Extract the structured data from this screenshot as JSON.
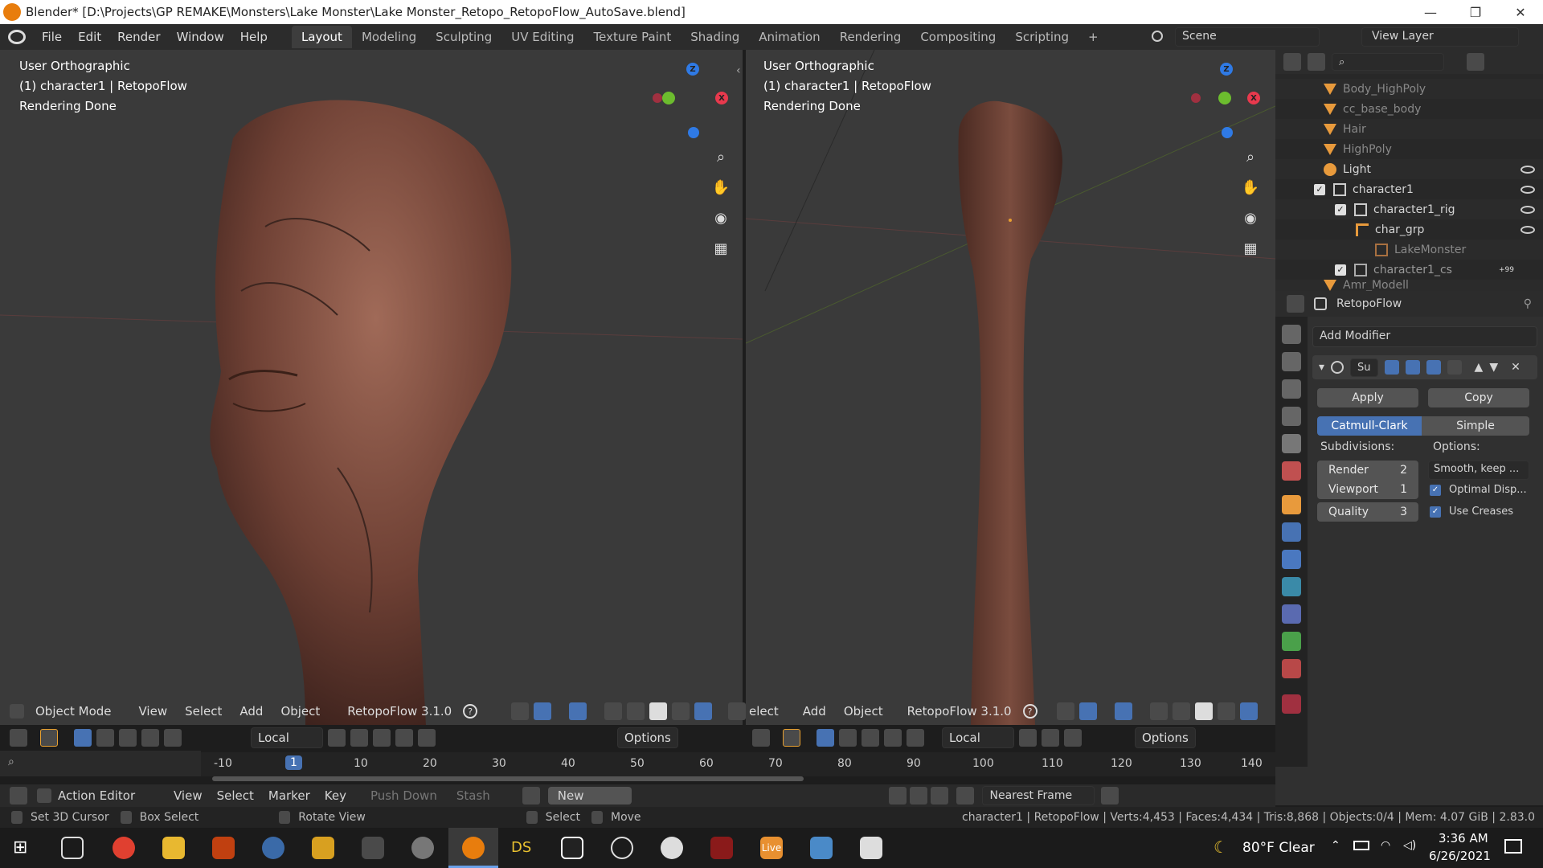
{
  "title_bar": {
    "title": "Blender* [D:\\Projects\\GP REMAKE\\Monsters\\Lake Monster\\Lake Monster_Retopo_RetopoFlow_AutoSave.blend]",
    "minimize": "—",
    "maximize": "❐",
    "close": "✕"
  },
  "menu": {
    "items": [
      "File",
      "Edit",
      "Render",
      "Window",
      "Help"
    ]
  },
  "workspaces": {
    "tabs": [
      "Layout",
      "Modeling",
      "Sculpting",
      "UV Editing",
      "Texture Paint",
      "Shading",
      "Animation",
      "Rendering",
      "Compositing",
      "Scripting"
    ],
    "active": "Layout",
    "add": "+"
  },
  "scene": {
    "label": "Scene",
    "view_layer": "View Layer"
  },
  "viewport_left": {
    "line1": "User Orthographic",
    "line2": "(1) character1 | RetopoFlow",
    "line3": "Rendering Done"
  },
  "viewport_right": {
    "line1": "User Orthographic",
    "line2": "(1) character1 | RetopoFlow",
    "line3": "Rendering Done"
  },
  "gizmo": {
    "z": "Z",
    "x": "X"
  },
  "header_left": {
    "mode": "Object Mode",
    "view": "View",
    "select": "Select",
    "add": "Add",
    "object": "Object",
    "addon": "RetopoFlow 3.1.0",
    "pivot": "Local",
    "options": "Options"
  },
  "header_right": {
    "select": "elect",
    "add": "Add",
    "object": "Object",
    "addon": "RetopoFlow 3.1.0",
    "pivot": "Local",
    "options": "Options"
  },
  "outliner": {
    "items": [
      {
        "label": "Body_HighPoly",
        "dim": true
      },
      {
        "label": "cc_base_body",
        "dim": true
      },
      {
        "label": "Hair",
        "dim": true
      },
      {
        "label": "HighPoly",
        "dim": true
      },
      {
        "label": "Light",
        "dim": false
      },
      {
        "label": "character1",
        "dim": false
      },
      {
        "label": "character1_rig",
        "dim": false
      },
      {
        "label": "char_grp",
        "dim": false
      },
      {
        "label": "LakeMonster",
        "dim": true
      },
      {
        "label": "character1_cs",
        "dim": true
      },
      {
        "label": "Amr_Modell",
        "dim": true
      }
    ],
    "badge": "+99"
  },
  "properties": {
    "object_name": "RetopoFlow",
    "add_modifier": "Add Modifier",
    "modifier_name": "Su",
    "apply": "Apply",
    "copy": "Copy",
    "catmull": "Catmull-Clark",
    "simple": "Simple",
    "subdivisions_label": "Subdivisions:",
    "options_label": "Options:",
    "render_label": "Render",
    "render_value": "2",
    "viewport_label": "Viewport",
    "viewport_value": "1",
    "quality_label": "Quality",
    "quality_value": "3",
    "uv_smooth": "Smooth, keep ...",
    "optimal": "Optimal Disp...",
    "creases": "Use Creases"
  },
  "timeline": {
    "current_frame": "1",
    "ticks": [
      "-10",
      "10",
      "20",
      "30",
      "40",
      "50",
      "60",
      "70",
      "80",
      "90",
      "100",
      "110",
      "120",
      "130",
      "140"
    ]
  },
  "action_editor": {
    "editor": "Action Editor",
    "view": "View",
    "select": "Select",
    "marker": "Marker",
    "key": "Key",
    "push_down": "Push Down",
    "stash": "Stash",
    "new": "New",
    "snap": "Nearest Frame"
  },
  "status": {
    "cursor": "Set 3D Cursor",
    "box": "Box Select",
    "rotate": "Rotate View",
    "select": "Select",
    "move": "Move",
    "stats": "character1 | RetopoFlow | Verts:4,453 | Faces:4,434 | Tris:8,868 | Objects:0/4 | Mem: 4.07 GiB | 2.83.0"
  },
  "taskbar": {
    "weather": "80°F Clear",
    "time": "3:36 AM",
    "date": "6/26/2021",
    "ds_label": "DS",
    "live_label": "Live"
  },
  "colors": {
    "accent": "#4772b3",
    "axis_x": "#e8394d",
    "axis_y": "#6cbc2e",
    "axis_z": "#2f7ae5",
    "orange": "#e89a3c"
  }
}
